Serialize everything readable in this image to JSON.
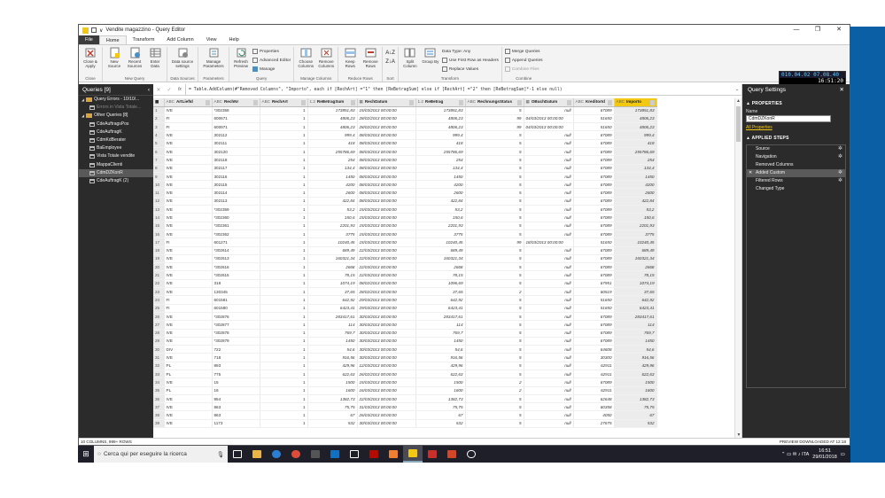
{
  "window": {
    "title": "Vendite magazzino - Query Editor",
    "qa_label": "∨",
    "minimize": "—",
    "restore": "❐",
    "close": "✕"
  },
  "ribbon_tabs": [
    "File",
    "Home",
    "Transform",
    "Add Column",
    "View",
    "Help"
  ],
  "ribbon": {
    "close_group": {
      "label": "Close",
      "btn": "Close & Apply"
    },
    "newquery_group": {
      "label": "New Query",
      "btns": [
        "New Source",
        "Recent Sources",
        "Enter Data"
      ]
    },
    "datasources_group": {
      "label": "Data Sources",
      "btn": "Data source settings"
    },
    "parameters_group": {
      "label": "Parameters",
      "btn": "Manage Parameters"
    },
    "query_group": {
      "label": "Query",
      "btn": "Refresh Preview",
      "small": [
        "Properties",
        "Advanced Editor",
        "Manage"
      ]
    },
    "manage_columns_group": {
      "label": "Manage Columns",
      "btns": [
        "Choose Columns",
        "Remove Columns"
      ]
    },
    "reduce_rows_group": {
      "label": "Reduce Rows",
      "btns": [
        "Keep Rows",
        "Remove Rows"
      ]
    },
    "sort_group": {
      "label": "Sort"
    },
    "transform_group": {
      "label": "Transform",
      "btns": [
        "Split Column",
        "Group By"
      ],
      "small": [
        "Data Type: Any",
        "Use First Row as Headers",
        "Replace Values"
      ]
    },
    "combine_group": {
      "label": "Combine",
      "small": [
        "Merge Queries",
        "Append Queries",
        "Combine Files"
      ]
    }
  },
  "clock": {
    "line1": "010.04.02 07.08.40",
    "line2": "16:51:20"
  },
  "left_panel": {
    "title": "Queries [9]",
    "collapse": "‹",
    "items": [
      {
        "label": "Query Errors - 10/10/...",
        "kind": "folder"
      },
      {
        "label": "Errors in Vista Totale...",
        "kind": "error"
      },
      {
        "label": "Other Queries [8]",
        "kind": "folder"
      },
      {
        "label": "CdeAuftragsPos",
        "kind": "table"
      },
      {
        "label": "CdeAuftragK",
        "kind": "table"
      },
      {
        "label": "CdmKdBerater",
        "kind": "table"
      },
      {
        "label": "BaEmployee",
        "kind": "table"
      },
      {
        "label": "Vista Totale vendite",
        "kind": "table"
      },
      {
        "label": "MappaClienti",
        "kind": "table"
      },
      {
        "label": "CdmDZKonR",
        "kind": "table"
      },
      {
        "label": "CdeAuftragK (2)",
        "kind": "table"
      }
    ]
  },
  "formula_bar": {
    "cancel": "✕",
    "confirm": "✓",
    "fx": "fx",
    "text": "= Table.AddColumn(#\"Removed Columns\", \"Importo\", each if [RechArt] =\"1\" then [ReBetragSum] else if [RechArt] =\"2\" then [ReBetragSum]*-1 else null)"
  },
  "table": {
    "columns": [
      {
        "type": "ABC",
        "name": "ArtLiefId"
      },
      {
        "type": "ABC",
        "name": "RechNr"
      },
      {
        "type": "ABC",
        "name": "RechArt"
      },
      {
        "type": "1.2",
        "name": "ReBetragSum"
      },
      {
        "type": "▦",
        "name": "RechDatum"
      },
      {
        "type": "1.2",
        "name": "ReBetrag"
      },
      {
        "type": "ABC",
        "name": "RechnungsStatus"
      },
      {
        "type": "▦",
        "name": "OBuchDatum"
      },
      {
        "type": "ABC",
        "name": "KreditorId"
      },
      {
        "type": "ABC",
        "name": "Importo"
      }
    ],
    "rows": [
      [
        "1",
        "IVE",
        "*302358",
        "1",
        "173851,83",
        "15/03/2013 00:00:00",
        "173851,83",
        "5",
        "null",
        "67089",
        "173851,83"
      ],
      [
        "2",
        "FI",
        "600671",
        "1",
        "4806,23",
        "28/02/2013 00:00:00",
        "4806,23",
        "99",
        "04/03/2013 00:00:00",
        "51650",
        "4806,23"
      ],
      [
        "3",
        "FI",
        "600971",
        "1",
        "4806,23",
        "28/02/2013 00:00:00",
        "4806,23",
        "99",
        "04/03/2013 00:00:00",
        "51650",
        "4806,23"
      ],
      [
        "4",
        "IVE",
        "302112",
        "1",
        "999,4",
        "08/03/2013 00:00:00",
        "999,4",
        "5",
        "null",
        "67089",
        "999,4"
      ],
      [
        "5",
        "IVE",
        "302111",
        "1",
        "418",
        "08/03/2013 00:00:00",
        "418",
        "5",
        "null",
        "67089",
        "418"
      ],
      [
        "6",
        "IVE",
        "302120",
        "1",
        "255786,69",
        "08/03/2013 00:00:00",
        "255786,69",
        "5",
        "null",
        "67089",
        "255786,69"
      ],
      [
        "7",
        "IVE",
        "302118",
        "1",
        "254",
        "08/03/2013 00:00:00",
        "254",
        "5",
        "null",
        "67089",
        "254"
      ],
      [
        "8",
        "IVE",
        "302117",
        "1",
        "134,4",
        "08/03/2013 00:00:00",
        "134,4",
        "5",
        "null",
        "67089",
        "134,4"
      ],
      [
        "9",
        "IVE",
        "302116",
        "1",
        "1450",
        "08/03/2013 00:00:00",
        "1450",
        "5",
        "null",
        "67089",
        "1450"
      ],
      [
        "10",
        "IVE",
        "302115",
        "1",
        "4200",
        "08/03/2013 00:00:00",
        "4200",
        "5",
        "null",
        "67089",
        "4200"
      ],
      [
        "11",
        "IVE",
        "302114",
        "1",
        "2600",
        "08/03/2013 00:00:00",
        "2600",
        "5",
        "null",
        "67089",
        "2600"
      ],
      [
        "12",
        "IVE",
        "302113",
        "1",
        "422,84",
        "08/03/2013 00:00:00",
        "422,84",
        "5",
        "null",
        "67089",
        "422,84"
      ],
      [
        "13",
        "IVE",
        "*302359",
        "1",
        "53,2",
        "15/03/2013 00:00:00",
        "53,2",
        "5",
        "null",
        "67089",
        "53,2"
      ],
      [
        "14",
        "IVE",
        "*302360",
        "1",
        "150,6",
        "15/03/2013 00:00:00",
        "150,6",
        "5",
        "null",
        "67089",
        "150,6"
      ],
      [
        "15",
        "IVE",
        "*302361",
        "1",
        "2201,93",
        "15/03/2013 00:00:00",
        "2201,93",
        "5",
        "null",
        "67089",
        "2201,93"
      ],
      [
        "16",
        "IVE",
        "*302362",
        "1",
        "3775",
        "15/03/2013 00:00:00",
        "3775",
        "5",
        "null",
        "67089",
        "3775"
      ],
      [
        "17",
        "FI",
        "601271",
        "1",
        "10240,45",
        "15/03/2013 00:00:00",
        "10240,45",
        "99",
        "18/03/2013 00:00:00",
        "51650",
        "10240,45"
      ],
      [
        "18",
        "IVE",
        "*302614",
        "1",
        "689,49",
        "22/03/2013 00:00:00",
        "689,49",
        "5",
        "null",
        "67089",
        "689,49"
      ],
      [
        "19",
        "IVE",
        "*302613",
        "1",
        "160321,34",
        "22/03/2013 00:00:00",
        "160321,34",
        "5",
        "null",
        "67089",
        "160321,34"
      ],
      [
        "20",
        "IVE",
        "*302616",
        "1",
        "2668",
        "22/03/2013 00:00:00",
        "2668",
        "5",
        "null",
        "67089",
        "2668"
      ],
      [
        "21",
        "IVE",
        "*302615",
        "1",
        "78,15",
        "22/03/2013 00:00:00",
        "78,15",
        "5",
        "null",
        "67089",
        "78,15"
      ],
      [
        "22",
        "IVE",
        "318",
        "1",
        "1074,19",
        "08/02/2013 00:00:00",
        "1096,69",
        "5",
        "null",
        "67951",
        "1074,19"
      ],
      [
        "23",
        "IVE",
        "130345",
        "1",
        "37,65",
        "28/02/2013 00:00:00",
        "37,65",
        "2",
        "null",
        "60519",
        "37,65"
      ],
      [
        "24",
        "FI",
        "601581",
        "1",
        "642,92",
        "29/03/2013 00:00:00",
        "642,92",
        "5",
        "null",
        "51650",
        "642,92"
      ],
      [
        "25",
        "FI",
        "601580",
        "1",
        "6423,41",
        "29/03/2013 00:00:00",
        "6423,41",
        "5",
        "null",
        "51650",
        "6423,41"
      ],
      [
        "26",
        "IVE",
        "*302876",
        "1",
        "283417,61",
        "30/03/2013 00:00:00",
        "283417,61",
        "5",
        "null",
        "67089",
        "283417,61"
      ],
      [
        "27",
        "IVE",
        "*302877",
        "1",
        "114",
        "30/03/2013 00:00:00",
        "114",
        "5",
        "null",
        "67089",
        "114"
      ],
      [
        "28",
        "IVE",
        "*302878",
        "1",
        "769,7",
        "30/03/2013 00:00:00",
        "769,7",
        "5",
        "null",
        "67089",
        "769,7"
      ],
      [
        "29",
        "IVE",
        "*302879",
        "1",
        "1450",
        "30/03/2013 00:00:00",
        "1450",
        "5",
        "null",
        "67089",
        "1450"
      ],
      [
        "30",
        "DIV",
        "722",
        "1",
        "54,6",
        "30/03/2013 00:00:00",
        "54,6",
        "5",
        "null",
        "64608",
        "54,6"
      ],
      [
        "31",
        "IVE",
        "718",
        "1",
        "916,56",
        "30/03/2013 00:00:00",
        "916,56",
        "5",
        "null",
        "30300",
        "916,56"
      ],
      [
        "32",
        "PL",
        "893",
        "1",
        "429,96",
        "12/03/2013 00:00:00",
        "429,96",
        "5",
        "null",
        "62911",
        "429,96"
      ],
      [
        "33",
        "PL",
        "775",
        "1",
        "622,63",
        "26/02/2013 00:00:00",
        "622,63",
        "5",
        "null",
        "62911",
        "622,63"
      ],
      [
        "34",
        "IVE",
        "15",
        "1",
        "1500",
        "15/03/2013 00:00:00",
        "1500",
        "2",
        "null",
        "67089",
        "1500"
      ],
      [
        "35",
        "PL",
        "16",
        "1",
        "1600",
        "16/03/2013 00:00:00",
        "1600",
        "2",
        "null",
        "62911",
        "1600"
      ],
      [
        "36",
        "IVE",
        "954",
        "1",
        "1382,73",
        "22/03/2013 00:00:00",
        "1382,73",
        "5",
        "null",
        "62648",
        "1382,73"
      ],
      [
        "37",
        "IVE",
        "863",
        "1",
        "75,75",
        "31/03/2013 00:00:00",
        "75,75",
        "5",
        "null",
        "60358",
        "75,75"
      ],
      [
        "38",
        "IVE",
        "863",
        "1",
        "67",
        "26/03/2013 00:00:00",
        "67",
        "5",
        "null",
        "4050",
        "67"
      ],
      [
        "39",
        "IVE",
        "1173",
        "1",
        "532",
        "30/03/2013 00:00:00",
        "532",
        "5",
        "null",
        "27675",
        "532"
      ]
    ]
  },
  "right_panel": {
    "title": "Query Settings",
    "close": "✕",
    "properties_head": "▲ PROPERTIES",
    "name_label": "Name",
    "name_value": "CdmDZKonR",
    "all_properties": "All Properties",
    "steps_head": "▲ APPLIED STEPS",
    "steps": [
      "Source",
      "Navigation",
      "Removed Columns",
      "Added Custom",
      "Filtered Rows",
      "Changed Type"
    ]
  },
  "status": {
    "left": "10 COLUMNS, 999+ ROWS",
    "right": "PREVIEW DOWNLOADED AT 12:18"
  },
  "taskbar": {
    "search_placeholder": "Cerca qui per eseguire la ricerca",
    "time": "16:51",
    "date": "29/01/2018",
    "tray_icons": "⌃ ▭ ✉ ♪ ITA"
  },
  "colors": {
    "accent": "#f2c811",
    "panel_dark": "#2b2b2b",
    "taskbar": "#1f1f2a",
    "desktop_blue": "#0b5fa5"
  }
}
